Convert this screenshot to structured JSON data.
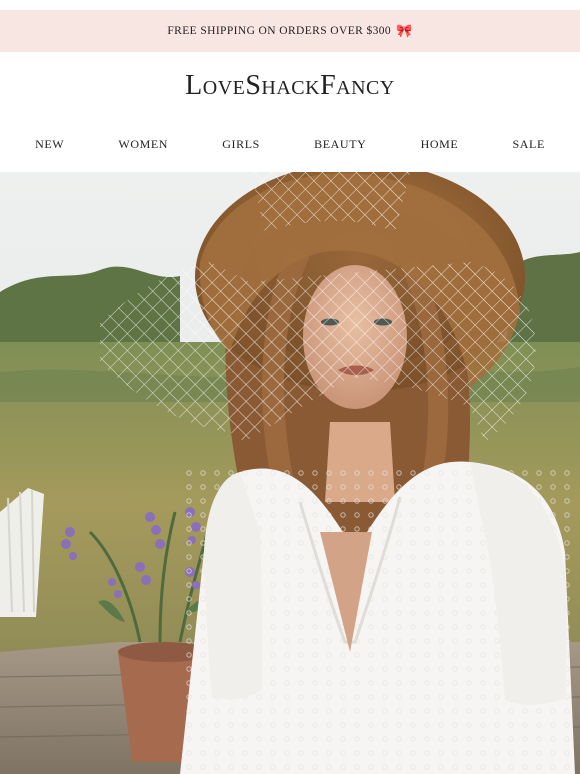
{
  "promo": {
    "text": "FREE SHIPPING ON ORDERS OVER $300",
    "icon": "bow-icon",
    "icon_color": "#e7588d",
    "background": "#f8e6e3"
  },
  "brand": {
    "logo_text": "LoveShackFancy"
  },
  "nav": {
    "items": [
      "NEW",
      "WOMEN",
      "GIRLS",
      "BEAUTY",
      "HOME",
      "SALE"
    ]
  },
  "hero": {
    "image": "photo-of-woman-in-straw-hat-with-veil-and-white-lace-dress-in-meadow"
  }
}
